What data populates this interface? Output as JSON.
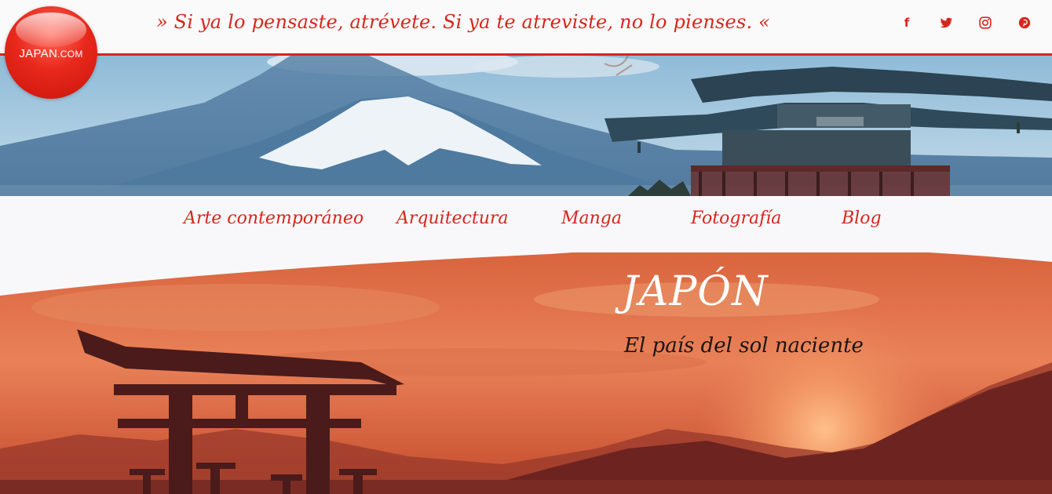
{
  "header": {
    "quote": "» Si ya lo pensaste, atrévete. Si ya te atreviste, no lo pienses. «",
    "social_icons": [
      "facebook-icon",
      "twitter-icon",
      "instagram-icon",
      "pinterest-icon"
    ],
    "social_glyphs": {
      "facebook": "f",
      "twitter": "🐦",
      "instagram": "◎",
      "pinterest": "℗"
    }
  },
  "logo": {
    "name": "JAPAN",
    "suffix": ".COM"
  },
  "nav": {
    "items": [
      {
        "label": "Arte contemporáneo"
      },
      {
        "label": "Arquitectura"
      },
      {
        "label": "Manga"
      },
      {
        "label": "Fotografía"
      },
      {
        "label": "Blog"
      }
    ]
  },
  "hero": {
    "title": "JAPÓN",
    "subtitle": "El país del sol naciente"
  },
  "colors": {
    "accent": "#d7261c",
    "background": "#f8f8fa",
    "hero_sky": "#e8734a"
  }
}
